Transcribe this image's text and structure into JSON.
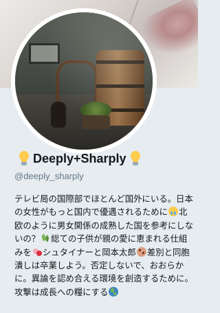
{
  "profile": {
    "display_name": "Deeply+Sharply",
    "name_prefix_icon": "light-bulb-emoji",
    "name_suffix_icon": "light-bulb-emoji",
    "handle": "@deeply_sharply",
    "avatar_description_icon": "profile-photo",
    "bio_segments": [
      {
        "type": "text",
        "value": "テレビ局の国際部でほとんど国外にいる。日本の女性がもっと国内で優遇されるために"
      },
      {
        "type": "emoji",
        "name": "crying-face"
      },
      {
        "type": "text",
        "value": "北欧のように男女関係の成熟した国を参考にしないの？"
      },
      {
        "type": "emoji",
        "name": "herb"
      },
      {
        "type": "text",
        "value": "総ての子供が親の愛に恵まれる仕組みを"
      },
      {
        "type": "emoji",
        "name": "revolving-hearts"
      },
      {
        "type": "text",
        "value": "シュタイナーと岡本太郎"
      },
      {
        "type": "emoji",
        "name": "cookie"
      },
      {
        "type": "text",
        "value": "差別と同胞潰しは卒業しよう。否定しないで、おおらかに。異論を認め合える環境を創造するために。攻撃は成長への糧にする"
      },
      {
        "type": "emoji",
        "name": "globe"
      }
    ]
  },
  "colors": {
    "page_background": "#e6ecf0",
    "handle_gray": "#657786",
    "text_dark": "#14171a"
  }
}
